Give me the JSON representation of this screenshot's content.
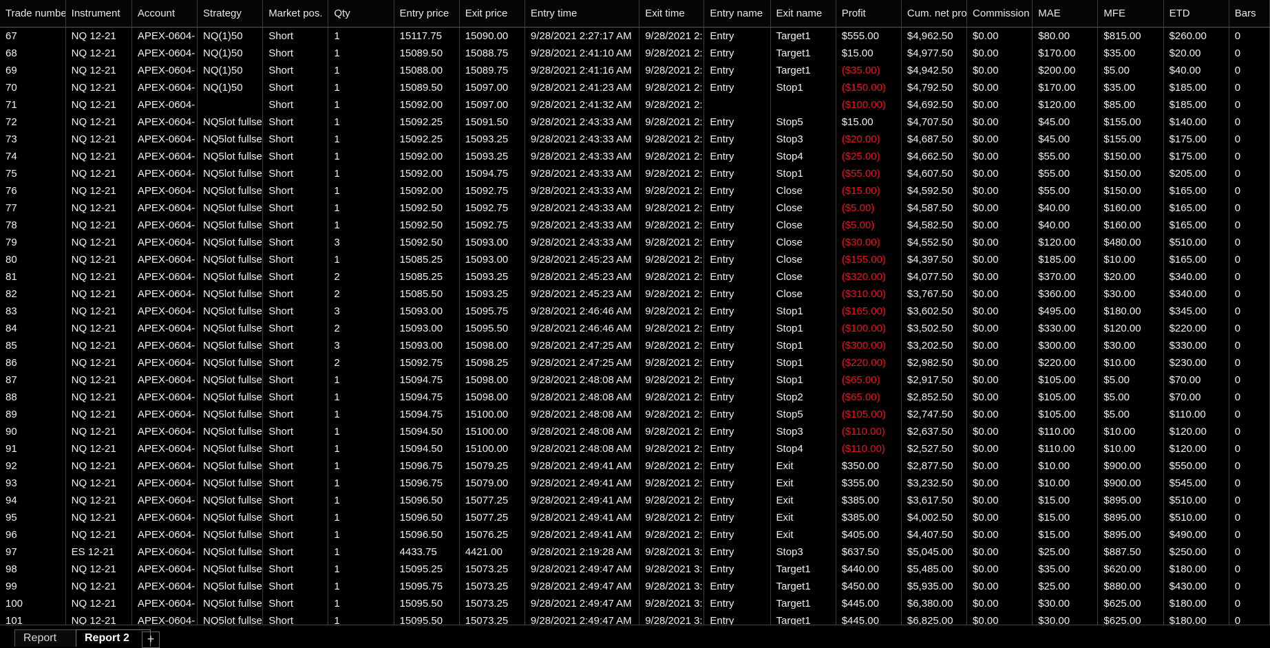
{
  "columns": [
    "Trade numbe",
    "Instrument",
    "Account",
    "Strategy",
    "Market pos.",
    "Qty",
    "Entry price",
    "Exit price",
    "Entry time",
    "Exit time",
    "Entry name",
    "Exit name",
    "Profit",
    "Cum. net pro",
    "Commission",
    "MAE",
    "MFE",
    "ETD",
    "Bars"
  ],
  "rows": [
    [
      "67",
      "NQ 12-21",
      "APEX-0604-",
      "NQ(1)50",
      "Short",
      "1",
      "15117.75",
      "15090.00",
      "9/28/2021 2:27:17 AM",
      "9/28/2021 2:",
      "Entry",
      "Target1",
      "$555.00",
      "$4,962.50",
      "$0.00",
      "$80.00",
      "$815.00",
      "$260.00",
      "0"
    ],
    [
      "68",
      "NQ 12-21",
      "APEX-0604-",
      "NQ(1)50",
      "Short",
      "1",
      "15089.50",
      "15088.75",
      "9/28/2021 2:41:10 AM",
      "9/28/2021 2:",
      "Entry",
      "Target1",
      "$15.00",
      "$4,977.50",
      "$0.00",
      "$170.00",
      "$35.00",
      "$20.00",
      "0"
    ],
    [
      "69",
      "NQ 12-21",
      "APEX-0604-",
      "NQ(1)50",
      "Short",
      "1",
      "15088.00",
      "15089.75",
      "9/28/2021 2:41:16 AM",
      "9/28/2021 2:",
      "Entry",
      "Target1",
      "($35.00)",
      "$4,942.50",
      "$0.00",
      "$200.00",
      "$5.00",
      "$40.00",
      "0"
    ],
    [
      "70",
      "NQ 12-21",
      "APEX-0604-",
      "NQ(1)50",
      "Short",
      "1",
      "15089.50",
      "15097.00",
      "9/28/2021 2:41:23 AM",
      "9/28/2021 2:",
      "Entry",
      "Stop1",
      "($150.00)",
      "$4,792.50",
      "$0.00",
      "$170.00",
      "$35.00",
      "$185.00",
      "0"
    ],
    [
      "71",
      "NQ 12-21",
      "APEX-0604-",
      "",
      "Short",
      "1",
      "15092.00",
      "15097.00",
      "9/28/2021 2:41:32 AM",
      "9/28/2021 2:",
      "",
      "",
      "($100.00)",
      "$4,692.50",
      "$0.00",
      "$120.00",
      "$85.00",
      "$185.00",
      "0"
    ],
    [
      "72",
      "NQ 12-21",
      "APEX-0604-",
      "NQ5lot fullse",
      "Short",
      "1",
      "15092.25",
      "15091.50",
      "9/28/2021 2:43:33 AM",
      "9/28/2021 2:",
      "Entry",
      "Stop5",
      "$15.00",
      "$4,707.50",
      "$0.00",
      "$45.00",
      "$155.00",
      "$140.00",
      "0"
    ],
    [
      "73",
      "NQ 12-21",
      "APEX-0604-",
      "NQ5lot fullse",
      "Short",
      "1",
      "15092.25",
      "15093.25",
      "9/28/2021 2:43:33 AM",
      "9/28/2021 2:",
      "Entry",
      "Stop3",
      "($20.00)",
      "$4,687.50",
      "$0.00",
      "$45.00",
      "$155.00",
      "$175.00",
      "0"
    ],
    [
      "74",
      "NQ 12-21",
      "APEX-0604-",
      "NQ5lot fullse",
      "Short",
      "1",
      "15092.00",
      "15093.25",
      "9/28/2021 2:43:33 AM",
      "9/28/2021 2:",
      "Entry",
      "Stop4",
      "($25.00)",
      "$4,662.50",
      "$0.00",
      "$55.00",
      "$150.00",
      "$175.00",
      "0"
    ],
    [
      "75",
      "NQ 12-21",
      "APEX-0604-",
      "NQ5lot fullse",
      "Short",
      "1",
      "15092.00",
      "15094.75",
      "9/28/2021 2:43:33 AM",
      "9/28/2021 2:",
      "Entry",
      "Stop1",
      "($55.00)",
      "$4,607.50",
      "$0.00",
      "$55.00",
      "$150.00",
      "$205.00",
      "0"
    ],
    [
      "76",
      "NQ 12-21",
      "APEX-0604-",
      "NQ5lot fullse",
      "Short",
      "1",
      "15092.00",
      "15092.75",
      "9/28/2021 2:43:33 AM",
      "9/28/2021 2:",
      "Entry",
      "Close",
      "($15.00)",
      "$4,592.50",
      "$0.00",
      "$55.00",
      "$150.00",
      "$165.00",
      "0"
    ],
    [
      "77",
      "NQ 12-21",
      "APEX-0604-",
      "NQ5lot fullse",
      "Short",
      "1",
      "15092.50",
      "15092.75",
      "9/28/2021 2:43:33 AM",
      "9/28/2021 2:",
      "Entry",
      "Close",
      "($5.00)",
      "$4,587.50",
      "$0.00",
      "$40.00",
      "$160.00",
      "$165.00",
      "0"
    ],
    [
      "78",
      "NQ 12-21",
      "APEX-0604-",
      "NQ5lot fullse",
      "Short",
      "1",
      "15092.50",
      "15092.75",
      "9/28/2021 2:43:33 AM",
      "9/28/2021 2:",
      "Entry",
      "Close",
      "($5.00)",
      "$4,582.50",
      "$0.00",
      "$40.00",
      "$160.00",
      "$165.00",
      "0"
    ],
    [
      "79",
      "NQ 12-21",
      "APEX-0604-",
      "NQ5lot fullse",
      "Short",
      "3",
      "15092.50",
      "15093.00",
      "9/28/2021 2:43:33 AM",
      "9/28/2021 2:",
      "Entry",
      "Close",
      "($30.00)",
      "$4,552.50",
      "$0.00",
      "$120.00",
      "$480.00",
      "$510.00",
      "0"
    ],
    [
      "80",
      "NQ 12-21",
      "APEX-0604-",
      "NQ5lot fullse",
      "Short",
      "1",
      "15085.25",
      "15093.00",
      "9/28/2021 2:45:23 AM",
      "9/28/2021 2:",
      "Entry",
      "Close",
      "($155.00)",
      "$4,397.50",
      "$0.00",
      "$185.00",
      "$10.00",
      "$165.00",
      "0"
    ],
    [
      "81",
      "NQ 12-21",
      "APEX-0604-",
      "NQ5lot fullse",
      "Short",
      "2",
      "15085.25",
      "15093.25",
      "9/28/2021 2:45:23 AM",
      "9/28/2021 2:",
      "Entry",
      "Close",
      "($320.00)",
      "$4,077.50",
      "$0.00",
      "$370.00",
      "$20.00",
      "$340.00",
      "0"
    ],
    [
      "82",
      "NQ 12-21",
      "APEX-0604-",
      "NQ5lot fullse",
      "Short",
      "2",
      "15085.50",
      "15093.25",
      "9/28/2021 2:45:23 AM",
      "9/28/2021 2:",
      "Entry",
      "Close",
      "($310.00)",
      "$3,767.50",
      "$0.00",
      "$360.00",
      "$30.00",
      "$340.00",
      "0"
    ],
    [
      "83",
      "NQ 12-21",
      "APEX-0604-",
      "NQ5lot fullse",
      "Short",
      "3",
      "15093.00",
      "15095.75",
      "9/28/2021 2:46:46 AM",
      "9/28/2021 2:",
      "Entry",
      "Stop1",
      "($165.00)",
      "$3,602.50",
      "$0.00",
      "$495.00",
      "$180.00",
      "$345.00",
      "0"
    ],
    [
      "84",
      "NQ 12-21",
      "APEX-0604-",
      "NQ5lot fullse",
      "Short",
      "2",
      "15093.00",
      "15095.50",
      "9/28/2021 2:46:46 AM",
      "9/28/2021 2:",
      "Entry",
      "Stop1",
      "($100.00)",
      "$3,502.50",
      "$0.00",
      "$330.00",
      "$120.00",
      "$220.00",
      "0"
    ],
    [
      "85",
      "NQ 12-21",
      "APEX-0604-",
      "NQ5lot fullse",
      "Short",
      "3",
      "15093.00",
      "15098.00",
      "9/28/2021 2:47:25 AM",
      "9/28/2021 2:",
      "Entry",
      "Stop1",
      "($300.00)",
      "$3,202.50",
      "$0.00",
      "$300.00",
      "$30.00",
      "$330.00",
      "0"
    ],
    [
      "86",
      "NQ 12-21",
      "APEX-0604-",
      "NQ5lot fullse",
      "Short",
      "2",
      "15092.75",
      "15098.25",
      "9/28/2021 2:47:25 AM",
      "9/28/2021 2:",
      "Entry",
      "Stop1",
      "($220.00)",
      "$2,982.50",
      "$0.00",
      "$220.00",
      "$10.00",
      "$230.00",
      "0"
    ],
    [
      "87",
      "NQ 12-21",
      "APEX-0604-",
      "NQ5lot fullse",
      "Short",
      "1",
      "15094.75",
      "15098.00",
      "9/28/2021 2:48:08 AM",
      "9/28/2021 2:",
      "Entry",
      "Stop1",
      "($65.00)",
      "$2,917.50",
      "$0.00",
      "$105.00",
      "$5.00",
      "$70.00",
      "0"
    ],
    [
      "88",
      "NQ 12-21",
      "APEX-0604-",
      "NQ5lot fullse",
      "Short",
      "1",
      "15094.75",
      "15098.00",
      "9/28/2021 2:48:08 AM",
      "9/28/2021 2:",
      "Entry",
      "Stop2",
      "($65.00)",
      "$2,852.50",
      "$0.00",
      "$105.00",
      "$5.00",
      "$70.00",
      "0"
    ],
    [
      "89",
      "NQ 12-21",
      "APEX-0604-",
      "NQ5lot fullse",
      "Short",
      "1",
      "15094.75",
      "15100.00",
      "9/28/2021 2:48:08 AM",
      "9/28/2021 2:",
      "Entry",
      "Stop5",
      "($105.00)",
      "$2,747.50",
      "$0.00",
      "$105.00",
      "$5.00",
      "$110.00",
      "0"
    ],
    [
      "90",
      "NQ 12-21",
      "APEX-0604-",
      "NQ5lot fullse",
      "Short",
      "1",
      "15094.50",
      "15100.00",
      "9/28/2021 2:48:08 AM",
      "9/28/2021 2:",
      "Entry",
      "Stop3",
      "($110.00)",
      "$2,637.50",
      "$0.00",
      "$110.00",
      "$10.00",
      "$120.00",
      "0"
    ],
    [
      "91",
      "NQ 12-21",
      "APEX-0604-",
      "NQ5lot fullse",
      "Short",
      "1",
      "15094.50",
      "15100.00",
      "9/28/2021 2:48:08 AM",
      "9/28/2021 2:",
      "Entry",
      "Stop4",
      "($110.00)",
      "$2,527.50",
      "$0.00",
      "$110.00",
      "$10.00",
      "$120.00",
      "0"
    ],
    [
      "92",
      "NQ 12-21",
      "APEX-0604-",
      "NQ5lot fullse",
      "Short",
      "1",
      "15096.75",
      "15079.25",
      "9/28/2021 2:49:41 AM",
      "9/28/2021 2:",
      "Entry",
      "Exit",
      "$350.00",
      "$2,877.50",
      "$0.00",
      "$10.00",
      "$900.00",
      "$550.00",
      "0"
    ],
    [
      "93",
      "NQ 12-21",
      "APEX-0604-",
      "NQ5lot fullse",
      "Short",
      "1",
      "15096.75",
      "15079.00",
      "9/28/2021 2:49:41 AM",
      "9/28/2021 2:",
      "Entry",
      "Exit",
      "$355.00",
      "$3,232.50",
      "$0.00",
      "$10.00",
      "$900.00",
      "$545.00",
      "0"
    ],
    [
      "94",
      "NQ 12-21",
      "APEX-0604-",
      "NQ5lot fullse",
      "Short",
      "1",
      "15096.50",
      "15077.25",
      "9/28/2021 2:49:41 AM",
      "9/28/2021 2:",
      "Entry",
      "Exit",
      "$385.00",
      "$3,617.50",
      "$0.00",
      "$15.00",
      "$895.00",
      "$510.00",
      "0"
    ],
    [
      "95",
      "NQ 12-21",
      "APEX-0604-",
      "NQ5lot fullse",
      "Short",
      "1",
      "15096.50",
      "15077.25",
      "9/28/2021 2:49:41 AM",
      "9/28/2021 2:",
      "Entry",
      "Exit",
      "$385.00",
      "$4,002.50",
      "$0.00",
      "$15.00",
      "$895.00",
      "$510.00",
      "0"
    ],
    [
      "96",
      "NQ 12-21",
      "APEX-0604-",
      "NQ5lot fullse",
      "Short",
      "1",
      "15096.50",
      "15076.25",
      "9/28/2021 2:49:41 AM",
      "9/28/2021 2:",
      "Entry",
      "Exit",
      "$405.00",
      "$4,407.50",
      "$0.00",
      "$15.00",
      "$895.00",
      "$490.00",
      "0"
    ],
    [
      "97",
      "ES 12-21",
      "APEX-0604-",
      "NQ5lot fullse",
      "Short",
      "1",
      "4433.75",
      "4421.00",
      "9/28/2021 2:19:28 AM",
      "9/28/2021 3:",
      "Entry",
      "Stop3",
      "$637.50",
      "$5,045.00",
      "$0.00",
      "$25.00",
      "$887.50",
      "$250.00",
      "0"
    ],
    [
      "98",
      "NQ 12-21",
      "APEX-0604-",
      "NQ5lot fullse",
      "Short",
      "1",
      "15095.25",
      "15073.25",
      "9/28/2021 2:49:47 AM",
      "9/28/2021 3:",
      "Entry",
      "Target1",
      "$440.00",
      "$5,485.00",
      "$0.00",
      "$35.00",
      "$620.00",
      "$180.00",
      "0"
    ],
    [
      "99",
      "NQ 12-21",
      "APEX-0604-",
      "NQ5lot fullse",
      "Short",
      "1",
      "15095.75",
      "15073.25",
      "9/28/2021 2:49:47 AM",
      "9/28/2021 3:",
      "Entry",
      "Target1",
      "$450.00",
      "$5,935.00",
      "$0.00",
      "$25.00",
      "$880.00",
      "$430.00",
      "0"
    ],
    [
      "100",
      "NQ 12-21",
      "APEX-0604-",
      "NQ5lot fullse",
      "Short",
      "1",
      "15095.50",
      "15073.25",
      "9/28/2021 2:49:47 AM",
      "9/28/2021 3:",
      "Entry",
      "Target1",
      "$445.00",
      "$6,380.00",
      "$0.00",
      "$30.00",
      "$625.00",
      "$180.00",
      "0"
    ],
    [
      "101",
      "NQ 12-21",
      "APEX-0604-",
      "NQ5lot fullse",
      "Short",
      "1",
      "15095.50",
      "15073.25",
      "9/28/2021 2:49:47 AM",
      "9/28/2021 3:",
      "Entry",
      "Target1",
      "$445.00",
      "$6,825.00",
      "$0.00",
      "$30.00",
      "$625.00",
      "$180.00",
      "0"
    ]
  ],
  "tabs": [
    "Report",
    "Report 2"
  ],
  "active_tab": "Report 2",
  "add_tab_label": "+",
  "colors": {
    "background": "#000000",
    "text": "#f0f0f0",
    "negative": "#e8141e",
    "grid_line": "#3a3a3a"
  }
}
